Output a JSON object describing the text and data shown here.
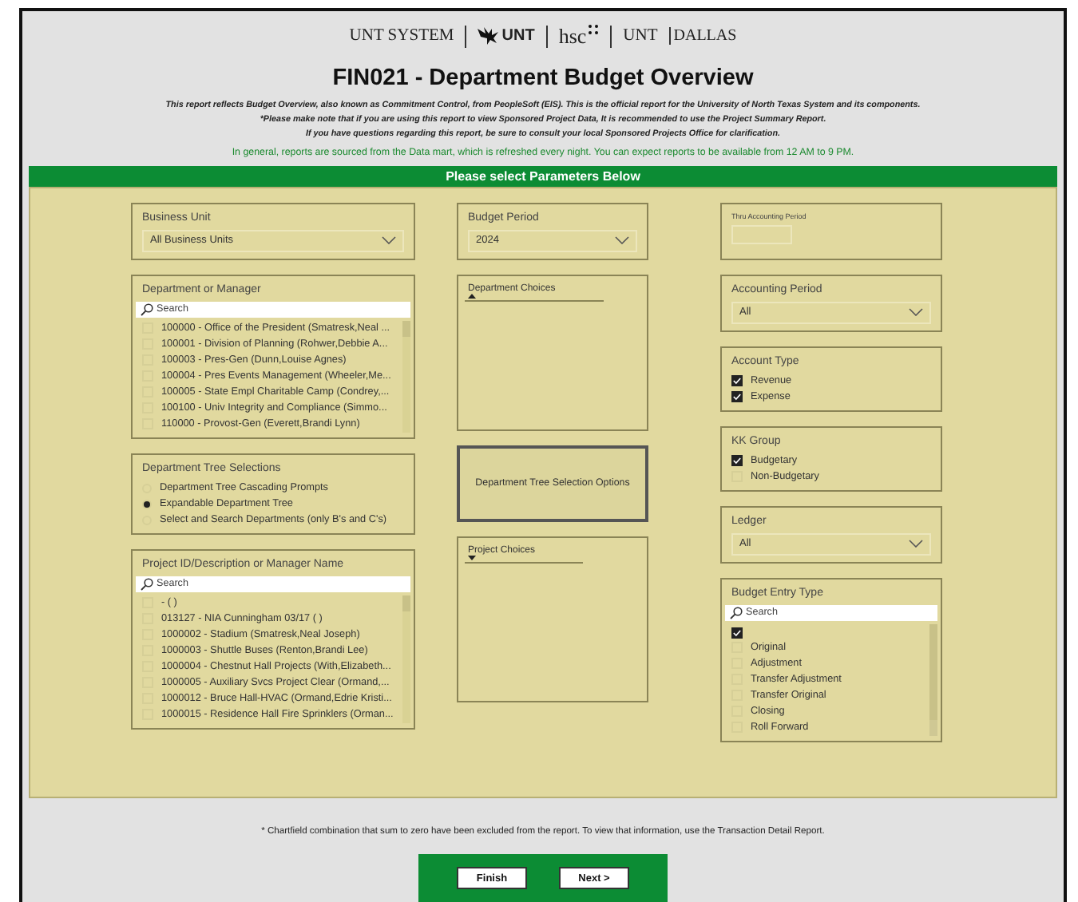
{
  "logos": [
    {
      "kind": "system",
      "text": "UNT SYSTEM"
    },
    {
      "kind": "eagle",
      "text": "UNT"
    },
    {
      "kind": "hsc",
      "text": "hsc"
    },
    {
      "kind": "dallas",
      "text": "UNT",
      "suffix": "DALLAS"
    }
  ],
  "title": "FIN021 - Department Budget Overview",
  "notes": [
    "This report reflects Budget Overview, also known as Commitment Control, from PeopleSoft (EIS). This is the official report for the University of North Texas System and its components.",
    "*Please make note that if you are using this report to view Sponsored Project Data, It is recommended to use the Project Summary Report.",
    "If you have questions regarding this report, be sure to consult your local Sponsored Projects Office for clarification."
  ],
  "info": "In general, reports are sourced from the Data mart, which is refreshed every night. You can expect reports to be available from 12 AM to 9 PM.",
  "params_header": "Please select Parameters Below",
  "columns": [
    {
      "panels": [
        {
          "kind": "dropdown",
          "label": "Business Unit",
          "value": "All Business Units"
        },
        {
          "kind": "checklist",
          "label": "Department or Manager",
          "placeholder": "Search",
          "items": [
            {
              "text": "100000 - Office of the President (Smatresk,Neal ...",
              "checked": false
            },
            {
              "text": "100001 - Division of Planning (Rohwer,Debbie A...",
              "checked": false
            },
            {
              "text": "100003 - Pres-Gen (Dunn,Louise Agnes)",
              "checked": false
            },
            {
              "text": "100004 - Pres Events Management (Wheeler,Me...",
              "checked": false
            },
            {
              "text": "100005 - State Empl Charitable Camp (Condrey,...",
              "checked": false
            },
            {
              "text": "100100 - Univ Integrity and Compliance (Simmo...",
              "checked": false
            },
            {
              "text": "110000 - Provost-Gen (Everett,Brandi Lynn)",
              "checked": false
            }
          ]
        },
        {
          "kind": "radio",
          "label": "Department Tree Selections",
          "options": [
            {
              "text": "Department Tree Cascading Prompts",
              "selected": false
            },
            {
              "text": "Expandable Department Tree",
              "selected": true
            },
            {
              "text": "Select and Search Departments (only B's and C's)",
              "selected": false
            }
          ]
        },
        {
          "kind": "checklist",
          "label": "Project ID/Description or Manager Name",
          "placeholder": "Search",
          "items": [
            {
              "text": "- ( )",
              "checked": false
            },
            {
              "text": "013127 - NIA Cunningham 03/17 ( )",
              "checked": false
            },
            {
              "text": "1000002 - Stadium (Smatresk,Neal Joseph)",
              "checked": false
            },
            {
              "text": "1000003 - Shuttle Buses (Renton,Brandi Lee)",
              "checked": false
            },
            {
              "text": "1000004 - Chestnut Hall Projects (With,Elizabeth...",
              "checked": false
            },
            {
              "text": "1000005 - Auxiliary Svcs Project Clear (Ormand,...",
              "checked": false
            },
            {
              "text": "1000012 - Bruce Hall-HVAC (Ormand,Edrie Kristi...",
              "checked": false
            },
            {
              "text": "1000015 - Residence Hall Fire Sprinklers (Orman...",
              "checked": false
            }
          ]
        }
      ]
    },
    {
      "panels": [
        {
          "kind": "dropdown",
          "label": "Budget Period",
          "value": "2024"
        },
        {
          "kind": "choices",
          "label": "Department Choices",
          "expanded": true
        },
        {
          "kind": "action",
          "label": "Department Tree Selection Options"
        },
        {
          "kind": "choices",
          "label": "Project Choices",
          "expanded": false
        }
      ]
    },
    {
      "panels": [
        {
          "kind": "input",
          "label": "Thru Accounting Period"
        },
        {
          "kind": "dropdown",
          "label": "Accounting Period",
          "value": "All"
        },
        {
          "kind": "checkboxes",
          "label": "Account Type",
          "items": [
            {
              "text": "Revenue",
              "checked": true
            },
            {
              "text": "Expense",
              "checked": true
            }
          ]
        },
        {
          "kind": "checkboxes",
          "label": "KK Group",
          "items": [
            {
              "text": "Budgetary",
              "checked": true
            },
            {
              "text": "Non-Budgetary",
              "checked": false
            }
          ]
        },
        {
          "kind": "dropdown",
          "label": "Ledger",
          "value": "All"
        },
        {
          "kind": "checklist",
          "label": "Budget Entry Type",
          "placeholder": "Search",
          "items": [
            {
              "checked": true
            },
            {
              "text": "Original",
              "checked": false
            },
            {
              "text": "Adjustment",
              "checked": false
            },
            {
              "text": "Transfer Adjustment",
              "checked": false
            },
            {
              "text": "Transfer Original",
              "checked": false
            },
            {
              "text": "Closing",
              "checked": false
            },
            {
              "text": "Roll Forward",
              "checked": false
            }
          ]
        }
      ]
    }
  ],
  "footer_note": "* Chartfield combination that sum to zero have been excluded from the report. To view that information, use the Transaction Detail Report.",
  "buttons": [
    "Finish",
    "Next >"
  ]
}
